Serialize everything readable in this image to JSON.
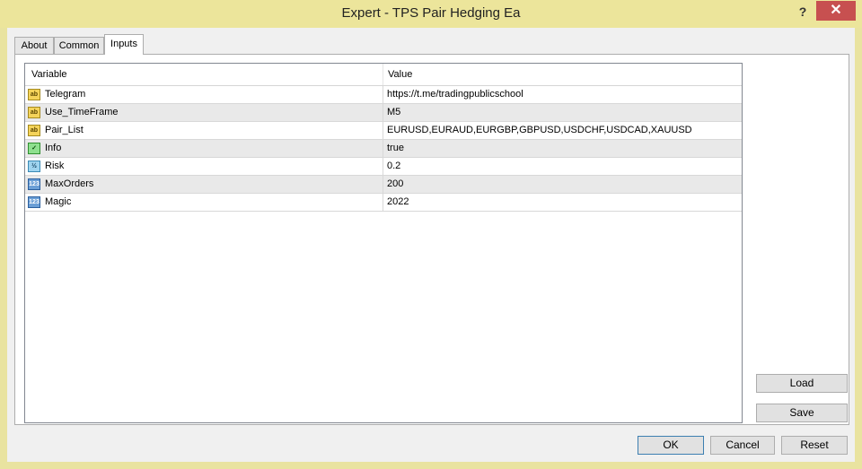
{
  "window": {
    "title": "Expert - TPS Pair Hedging Ea",
    "help_label": "?",
    "close_label": "✕"
  },
  "tabs": [
    {
      "label": "About"
    },
    {
      "label": "Common"
    },
    {
      "label": "Inputs",
      "active": true
    }
  ],
  "grid": {
    "columns": {
      "variable": "Variable",
      "value": "Value"
    },
    "rows": [
      {
        "icon": "string-icon",
        "icon_text": "ab",
        "variable": "Telegram",
        "value": "https://t.me/tradingpublicschool"
      },
      {
        "icon": "string-icon",
        "icon_text": "ab",
        "variable": "Use_TimeFrame",
        "value": "M5"
      },
      {
        "icon": "string-icon",
        "icon_text": "ab",
        "variable": "Pair_List",
        "value": "EURUSD,EURAUD,EURGBP,GBPUSD,USDCHF,USDCAD,XAUUSD"
      },
      {
        "icon": "bool-icon",
        "icon_text": "✓",
        "variable": "Info",
        "value": "true"
      },
      {
        "icon": "double-icon",
        "icon_text": "½",
        "variable": "Risk",
        "value": "0.2"
      },
      {
        "icon": "integer-icon",
        "icon_text": "123",
        "variable": "MaxOrders",
        "value": "200"
      },
      {
        "icon": "integer-icon",
        "icon_text": "123",
        "variable": "Magic",
        "value": "2022"
      }
    ]
  },
  "side_buttons": {
    "load": "Load",
    "save": "Save"
  },
  "footer_buttons": {
    "ok": "OK",
    "cancel": "Cancel",
    "reset": "Reset"
  }
}
